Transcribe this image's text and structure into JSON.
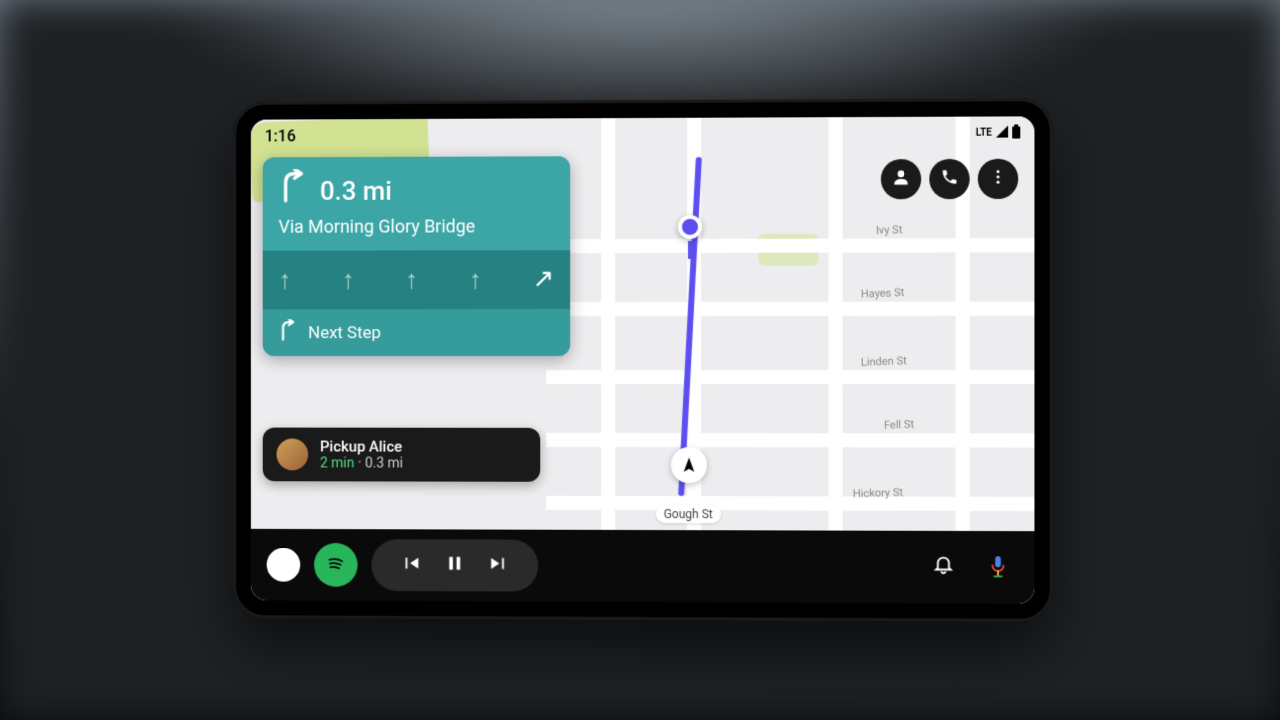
{
  "status": {
    "time": "1:16",
    "network": "LTE"
  },
  "actions": {
    "person": "person",
    "phone": "phone",
    "more": "more"
  },
  "nav": {
    "distance": "0.3 mi",
    "street": "Via Morning Glory Bridge",
    "next_label": "Next Step"
  },
  "pickup": {
    "title": "Pickup Alice",
    "eta": "2 min",
    "sep": " · ",
    "dist": "0.3 mi"
  },
  "map": {
    "streets": {
      "ivy": "Ivy St",
      "hayes": "Hayes St",
      "linden": "Linden St",
      "fell": "Fell St",
      "hickory": "Hickory St",
      "gough": "Gough St"
    }
  }
}
